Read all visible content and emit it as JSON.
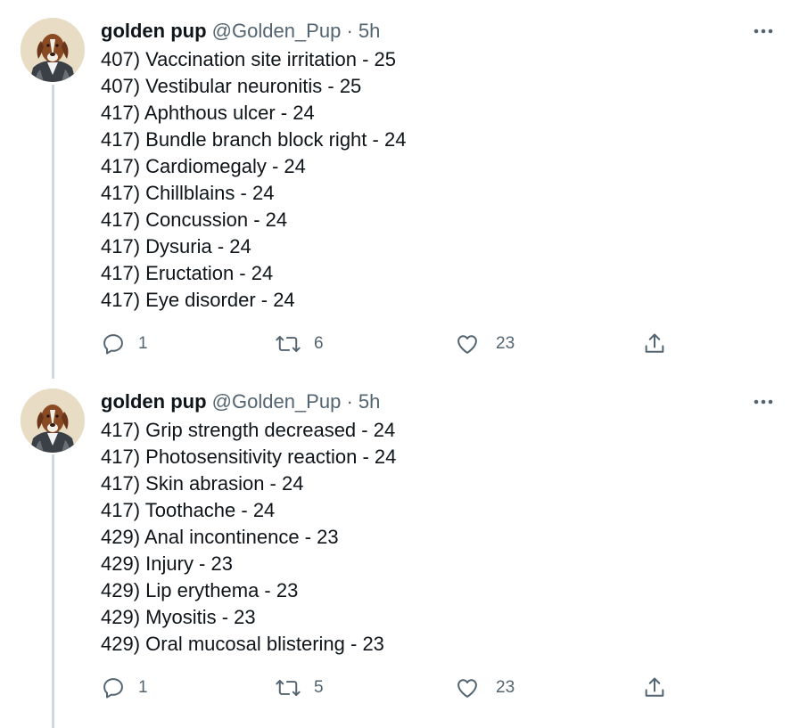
{
  "tweets": [
    {
      "author": {
        "name": "golden pup",
        "handle": "@Golden_Pup",
        "separator": "·",
        "time": "5h"
      },
      "lines": [
        "407) Vaccination site irritation - 25",
        "407) Vestibular neuronitis - 25",
        "417) Aphthous ulcer - 24",
        "417) Bundle branch block right - 24",
        "417) Cardiomegaly - 24",
        "417) Chillblains - 24",
        "417) Concussion - 24",
        "417) Dysuria - 24",
        "417) Eructation - 24",
        "417) Eye disorder - 24"
      ],
      "actions": {
        "reply_count": "1",
        "retweet_count": "6",
        "like_count": "23"
      }
    },
    {
      "author": {
        "name": "golden pup",
        "handle": "@Golden_Pup",
        "separator": "·",
        "time": "5h"
      },
      "lines": [
        "417) Grip strength decreased - 24",
        "417) Photosensitivity reaction - 24",
        "417) Skin abrasion - 24",
        "417) Toothache - 24",
        "429) Anal incontinence - 23",
        "429) Injury - 23",
        "429) Lip erythema - 23",
        "429) Myositis - 23",
        "429) Oral mucosal blistering - 23"
      ],
      "actions": {
        "reply_count": "1",
        "retweet_count": "5",
        "like_count": "23"
      }
    }
  ],
  "icons": {
    "reply": "reply-icon",
    "retweet": "retweet-icon",
    "like": "heart-icon",
    "share": "share-icon",
    "more": "more-icon",
    "avatar": "dog-portrait-avatar"
  },
  "colors": {
    "text": "#0f1419",
    "secondary": "#536471",
    "thread_line": "#cfd9de",
    "background": "#ffffff"
  }
}
